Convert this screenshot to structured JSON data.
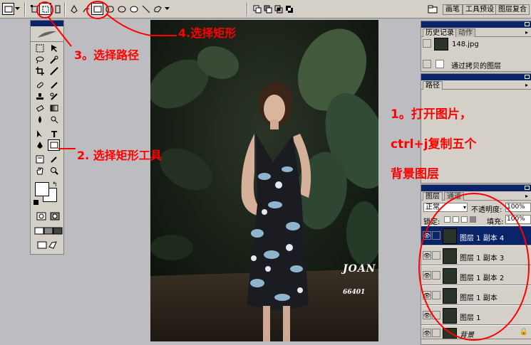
{
  "options_bar": {
    "icons": [
      "rectangle-shape-icon",
      "shape-layers-icon",
      "paths-icon",
      "fill-pixels-icon",
      "pen-icon",
      "freeform-pen-icon",
      "rectangle-tool-icon",
      "rounded-rectangle-icon",
      "ellipse-icon",
      "polygon-icon",
      "line-icon",
      "custom-shape-icon"
    ],
    "palette_tabs": [
      "画笔",
      "工具预设",
      "图层复合"
    ]
  },
  "toolbox": {
    "fg_color": "#ffffff",
    "bg_color": "#ffffff"
  },
  "canvas": {
    "brand": "JOAN",
    "code": "66401"
  },
  "history_panel": {
    "tabs": [
      "历史记录",
      "动作"
    ],
    "snapshot": "148.jpg",
    "step": "通过拷贝的图层"
  },
  "paths_panel": {
    "tab": "路径"
  },
  "layers_panel": {
    "tabs": [
      "图层",
      "通道"
    ],
    "blend_mode": "正常",
    "opacity_label": "不透明度:",
    "opacity_value": "100%",
    "lock_label": "锁定:",
    "fill_label": "填充:",
    "fill_value": "100%",
    "layers": [
      {
        "name": "图层 1 副本 4",
        "active": true
      },
      {
        "name": "图层 1 副本 3",
        "active": false
      },
      {
        "name": "图层 1 副本 2",
        "active": false
      },
      {
        "name": "图层 1 副本",
        "active": false
      },
      {
        "name": "图层 1",
        "active": false
      },
      {
        "name": "背景",
        "active": false
      }
    ]
  },
  "annotations": {
    "step1_line1": "1。打开图片，",
    "step1_line2": "ctrl+j复制五个",
    "step1_line3": "背景图层",
    "step2": "2. 选择矩形工具",
    "step3": "3。选择路径",
    "step4": "4.选择矩形",
    "color": "#ff0000"
  }
}
